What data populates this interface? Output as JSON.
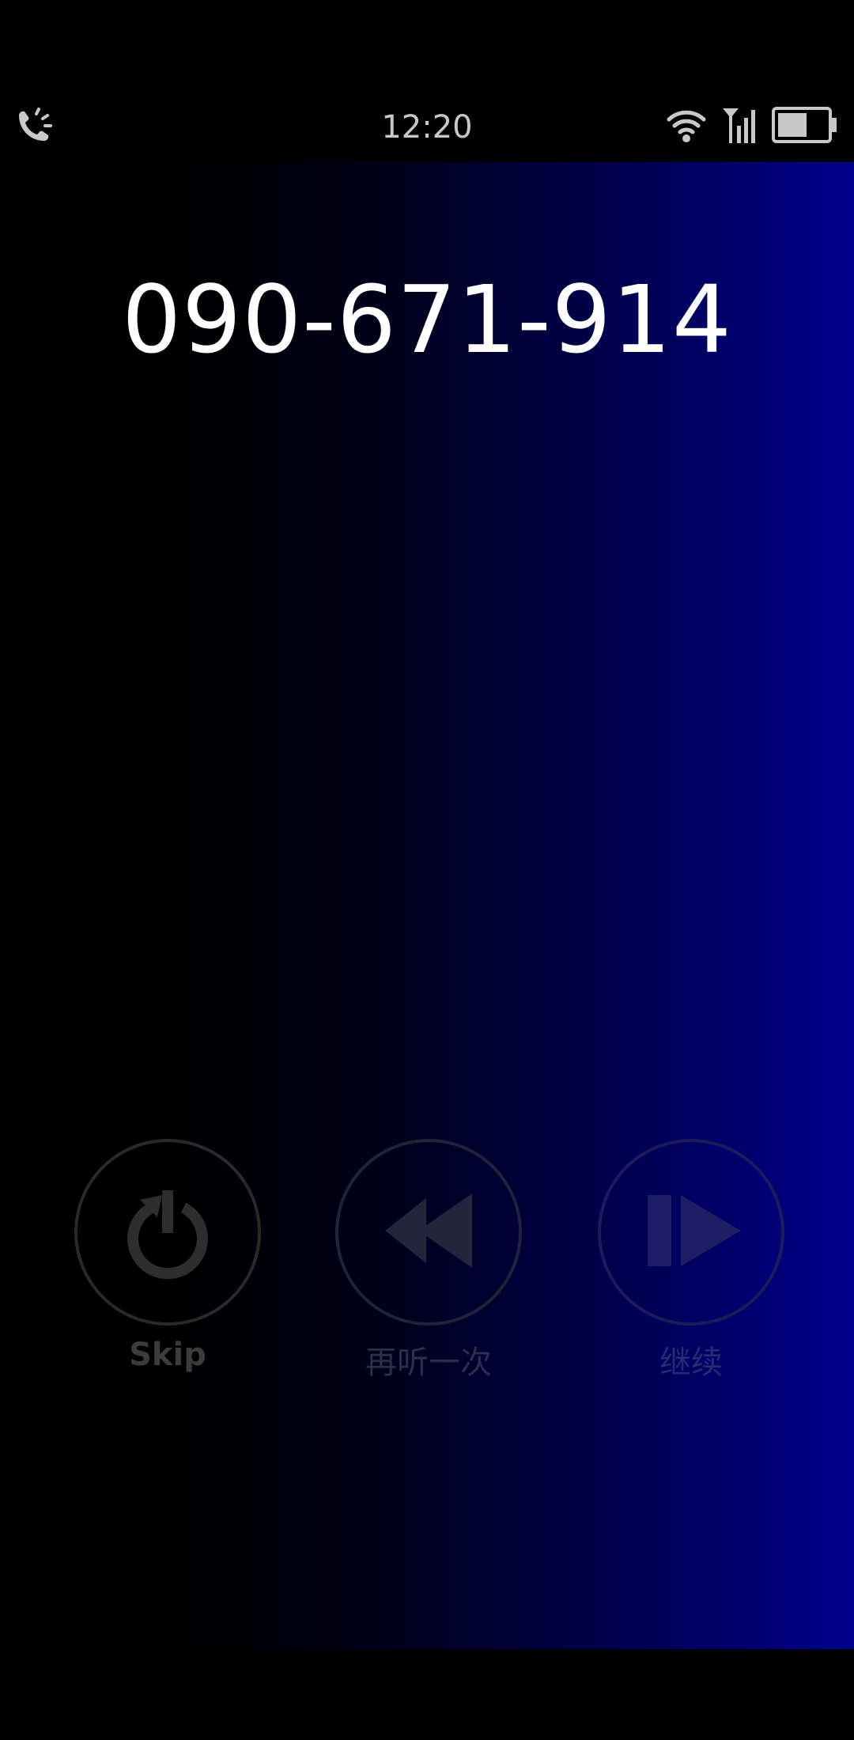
{
  "status_bar": {
    "time": "12:20",
    "left_icon": "phone-ringing-icon",
    "right_icons": [
      "wifi-icon",
      "signal-icon",
      "battery-icon"
    ]
  },
  "call": {
    "phone_number": "090-671-914"
  },
  "controls": {
    "skip": {
      "label": "Skip",
      "icon": "power-restart-icon"
    },
    "replay": {
      "label": "再听一次",
      "icon": "rewind-icon"
    },
    "continue": {
      "label": "继续",
      "icon": "play-next-icon"
    }
  },
  "colors": {
    "background": "#000000",
    "gradient_end": "#000090",
    "number_text": "#ffffff"
  }
}
